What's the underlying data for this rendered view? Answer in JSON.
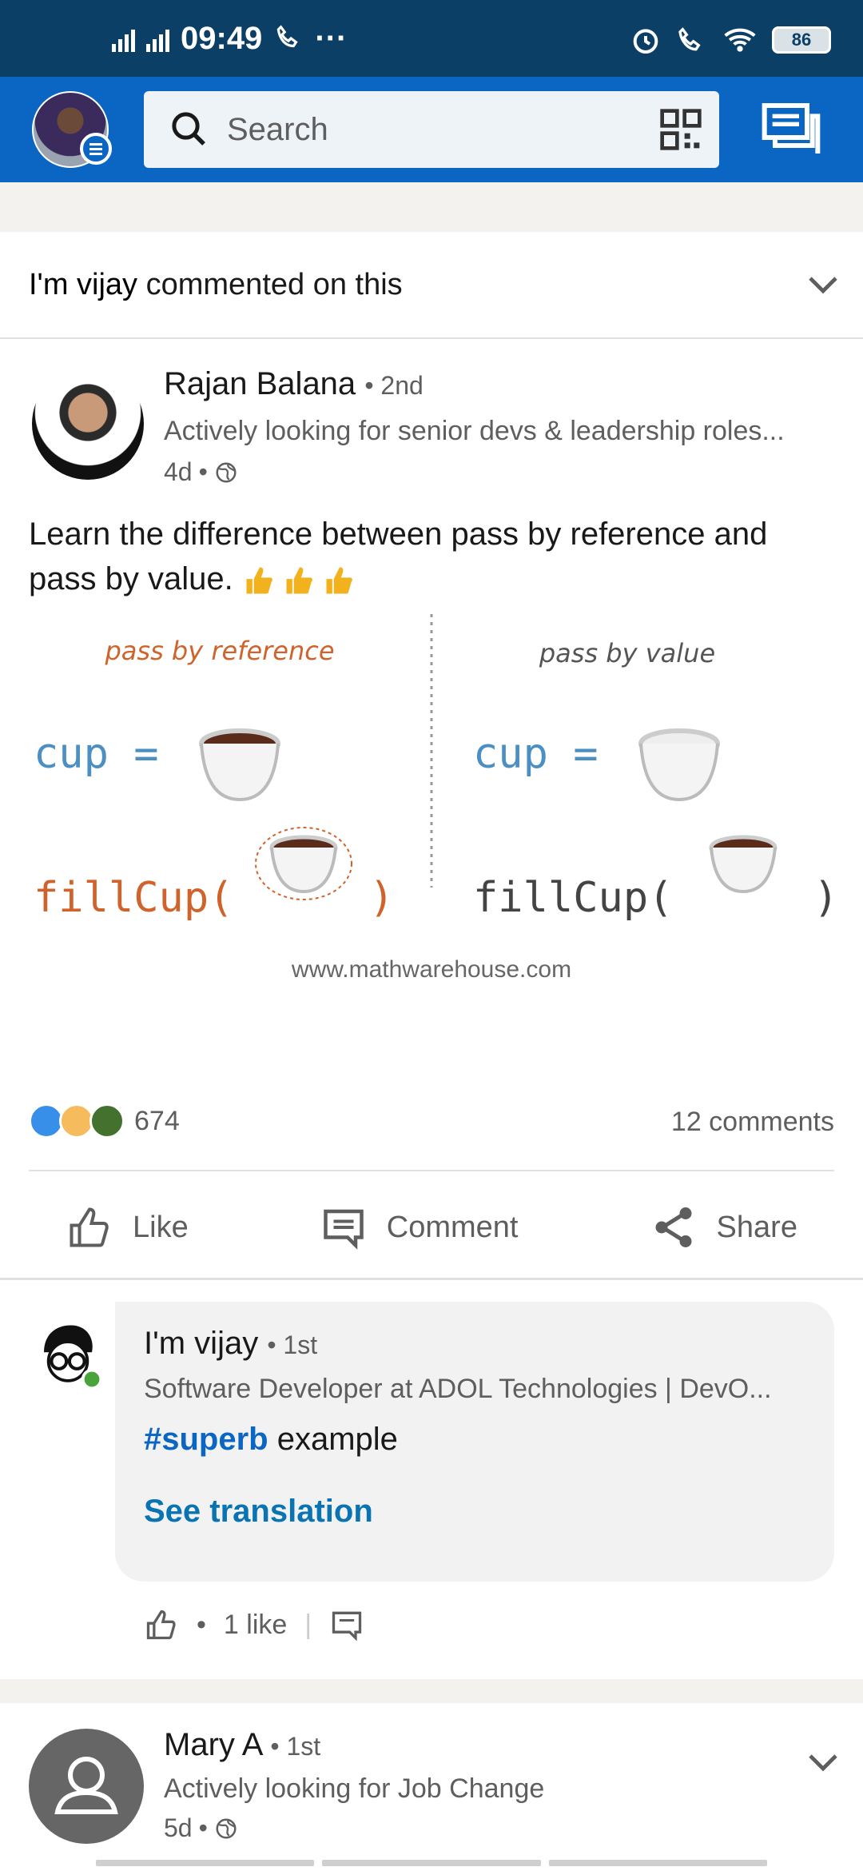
{
  "status_bar": {
    "time": "09:49",
    "battery": "86",
    "network1": "4G",
    "network2": "G",
    "more": "···"
  },
  "app_bar": {
    "search_placeholder": "Search"
  },
  "post_card": {
    "header_actor": "I'm vijay",
    "header_text": "commented on this",
    "author": "Rajan Balana",
    "author_degree": "2nd",
    "author_headline": "Actively looking for senior devs & leadership roles...",
    "time": "4d",
    "text": "Learn the difference between pass by reference and pass by value.",
    "image": {
      "left_title": "pass by reference",
      "right_title": "pass by value",
      "left_cup": "cup =",
      "right_cup": "cup =",
      "left_fill": "fillCup(",
      "left_fill_close": ")",
      "right_fill": "fillCup(",
      "right_fill_close": ")",
      "source": "www.mathwarehouse.com"
    },
    "reactions_count": "674",
    "comments_count": "12 comments",
    "actions": {
      "like": "Like",
      "comment": "Comment",
      "share": "Share"
    }
  },
  "comment": {
    "author": "I'm vijay",
    "degree": "1st",
    "headline": "Software Developer at ADOL Technologies | DevO...",
    "hashtag": "#superb",
    "text_rest": "example",
    "see_translation": "See translation",
    "likes": "1 like"
  },
  "next_post": {
    "author": "Mary A",
    "degree": "1st",
    "headline": "Actively looking for Job Change",
    "time": "5d"
  },
  "colors": {
    "status_bar": "#0b3f66",
    "app_bar": "#0a66c2",
    "hashtag": "#0a66c2",
    "link": "#0a74b3"
  },
  "icons": [
    "search-icon",
    "qr-code-icon",
    "messaging-icon",
    "chevron-down-icon",
    "globe-icon",
    "like-icon",
    "comment-icon",
    "share-icon"
  ]
}
